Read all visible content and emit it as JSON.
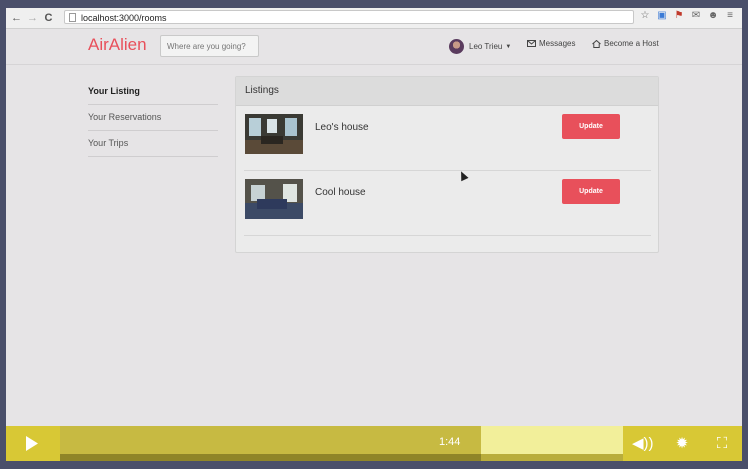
{
  "browser": {
    "url": "localhost:3000/rooms",
    "nav": [
      "←",
      "→",
      "C"
    ],
    "extensions": [
      "☆",
      "▣",
      "⚑",
      "✉",
      "☻",
      "≡"
    ]
  },
  "header": {
    "brand": "AirAlien",
    "search_placeholder": "Where are you going?",
    "user": "Leo Trieu",
    "messages": "Messages",
    "host": "Become a Host"
  },
  "sidebar": {
    "items": [
      {
        "label": "Your Listing"
      },
      {
        "label": "Your Reservations"
      },
      {
        "label": "Your Trips"
      }
    ]
  },
  "panel": {
    "title": "Listings",
    "rows": [
      {
        "title": "Leo's house",
        "button": "Update"
      },
      {
        "title": "Cool house",
        "button": "Update"
      }
    ]
  },
  "player": {
    "time": "1:44",
    "progress_percent": 57
  },
  "colors": {
    "brand": "#e8505b",
    "player": "#d8c835"
  }
}
